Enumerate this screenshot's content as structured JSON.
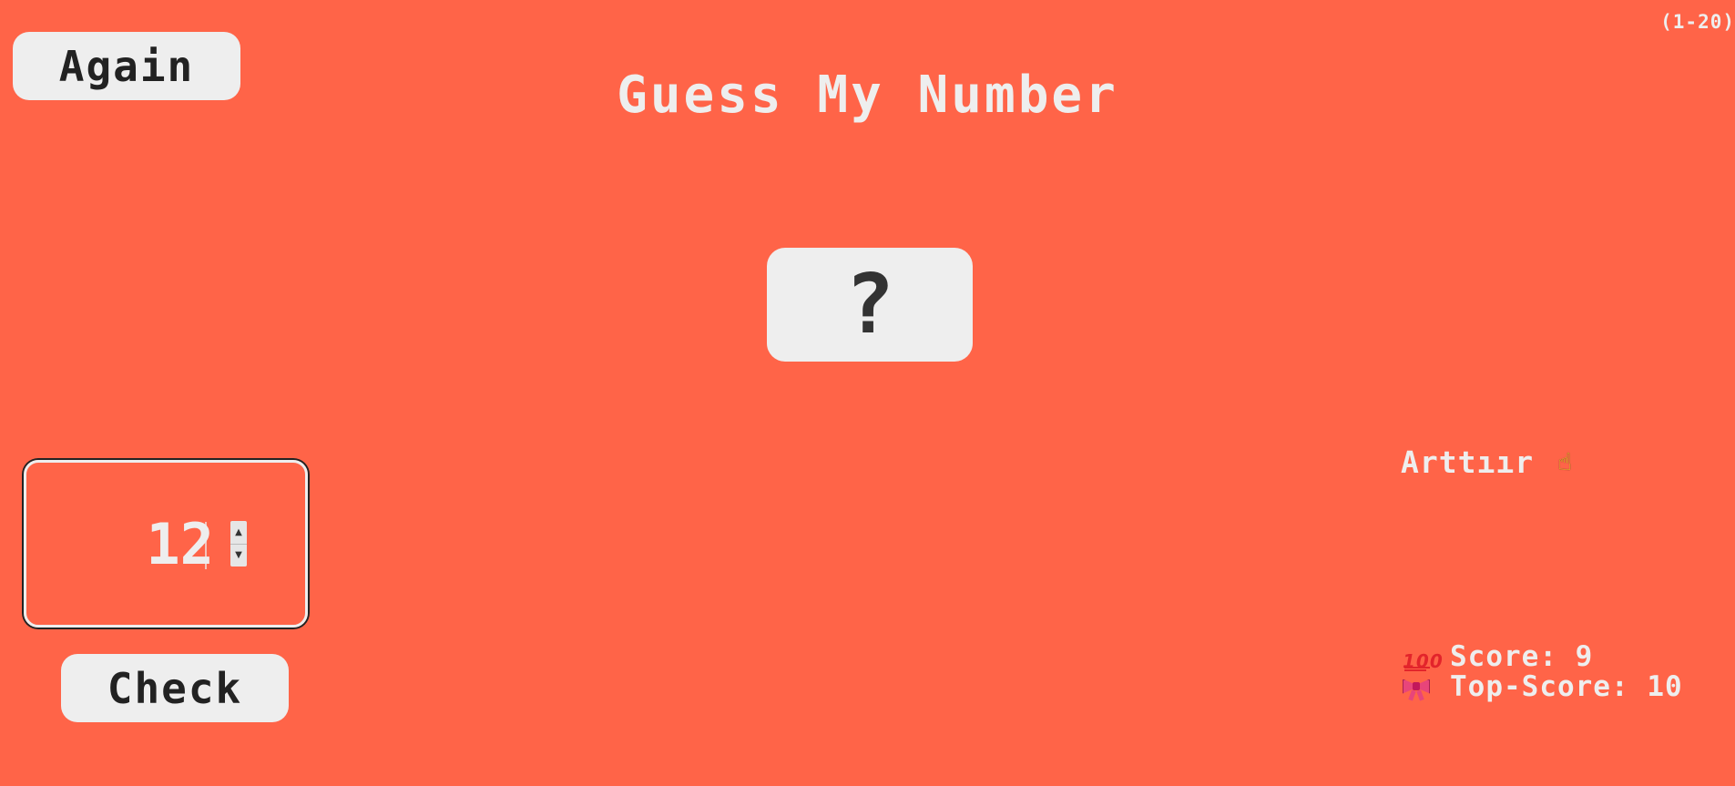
{
  "game": {
    "range_hint": "(1-20)",
    "title": "Guess My Number",
    "secret_display": "?",
    "again_label": "Again",
    "check_label": "Check",
    "guess_value": "12",
    "message": "Arttıır",
    "message_icon": "pointing-hand-icon",
    "score_label": "Score:",
    "score_value": "9",
    "top_score_label": "Top-Score:",
    "top_score_value": "10"
  },
  "icons": {
    "score": "hundred-points-icon",
    "top_score": "ribbon-icon"
  },
  "colors": {
    "background": "#ff6448",
    "text": "#eeeeee",
    "button_bg": "#eeeeee",
    "button_text": "#222222"
  }
}
